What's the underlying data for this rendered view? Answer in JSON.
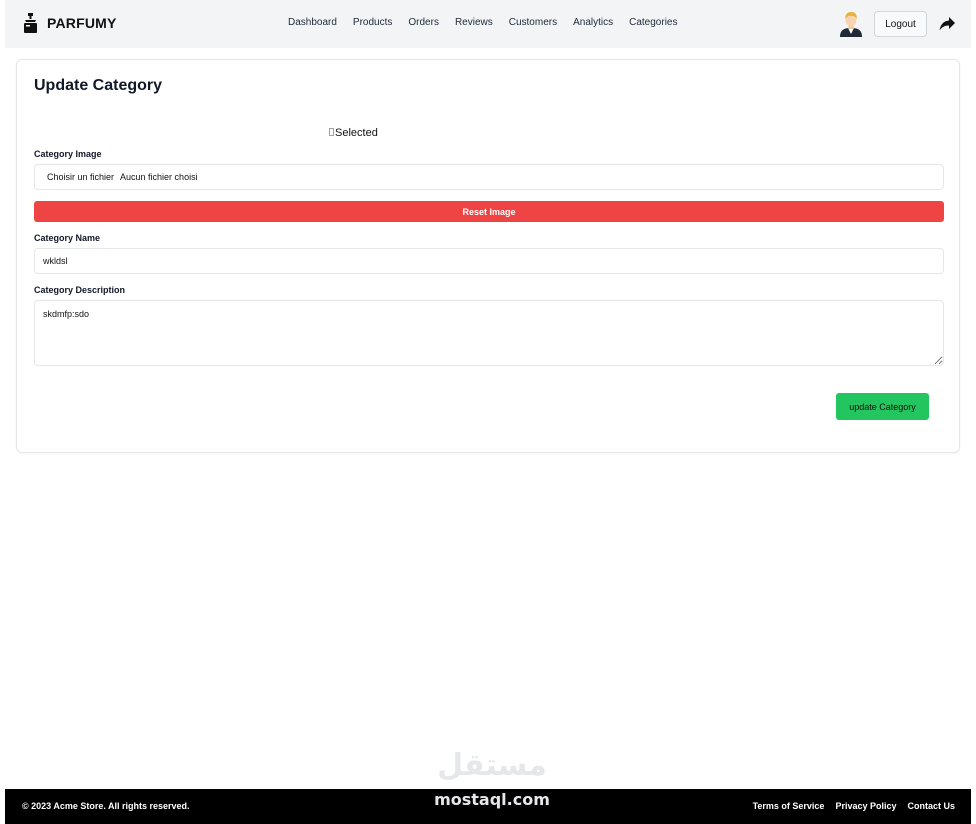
{
  "header": {
    "brand": "PARFUMY",
    "brand_icon": "perfume-bottle-icon",
    "nav": [
      "Dashboard",
      "Products",
      "Orders",
      "Reviews",
      "Customers",
      "Analytics",
      "Categories"
    ],
    "avatar_icon": "user-avatar-icon",
    "logout_label": "Logout",
    "share_icon": "share-arrow-icon"
  },
  "form": {
    "title": "Update Category",
    "preview_alt": "Selected",
    "image_label": "Category Image",
    "file_button": "Choisir un fichier",
    "file_status": "Aucun fichier choisi",
    "reset_label": "Reset Image",
    "name_label": "Category Name",
    "name_value": "wkldsl",
    "description_label": "Category Description",
    "description_value": "skdmfp:sdo",
    "submit_label": "update Category"
  },
  "watermark": {
    "arabic": "مستقل",
    "latin": "mostaql.com"
  },
  "footer": {
    "copyright": "© 2023 Acme Store. All rights reserved.",
    "links": [
      "Terms of Service",
      "Privacy Policy",
      "Contact Us"
    ]
  },
  "colors": {
    "header_bg": "#f3f4f6",
    "danger": "#ef4444",
    "success": "#22c55e",
    "footer_bg": "#000000"
  }
}
